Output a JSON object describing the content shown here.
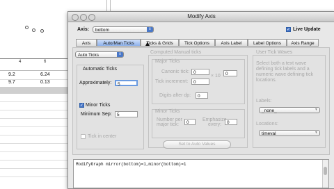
{
  "background": {
    "x_ticks": [
      "4",
      "6"
    ],
    "table_rows": [
      {
        "a": "9.2",
        "b": "6.24"
      },
      {
        "a": "9.7",
        "b": "0.13"
      }
    ]
  },
  "window": {
    "title": "Modify Axis",
    "axis_label": "Axis:",
    "axis_value": "bottom",
    "live_update_label": "Live Update",
    "tabs": [
      "Axis",
      "Auto/Man Ticks",
      "Ticks & Grids",
      "Tick Options",
      "Axis Label",
      "Label Options",
      "Axis Range"
    ],
    "active_tab": "Auto/Man Ticks",
    "mode_select": "Auto Ticks",
    "automatic": {
      "title": "Automatic Ticks",
      "approx_label": "Approximately:",
      "approx_value": "5",
      "minor_ticks_label": "Minor Ticks",
      "minor_sep_label": "Minimum Sep:",
      "minor_sep_value": "5",
      "tick_in_center_label": "Tick in center"
    },
    "computed": {
      "title": "Computed Manual ticks",
      "major_title": "Major Ticks",
      "canonic_label": "Canonic tick:",
      "canonic_value": "0",
      "increment_label": "Tick increment:",
      "increment_value": "0",
      "times10": "× 10",
      "exponent_value": "0",
      "digits_label": "Digits after dp:",
      "digits_value": "0",
      "minor_title": "Minor Ticks",
      "number_label_1": "Number per",
      "number_label_2": "major tick:",
      "number_value": "0",
      "emph_label_1": "Emphasize",
      "emph_label_2": "every:",
      "emph_value": "0",
      "set_button": "Set to Auto Values"
    },
    "user": {
      "title": "User Tick Waves",
      "desc": "Select both a text wave defining tick labels and a numeric wave defining tick locations.",
      "labels_label": "Labels:",
      "labels_value": "_none_",
      "locations_label": "Locations:",
      "locations_value": "timeval"
    },
    "command": "ModifyGraph mirror(bottom)=1,minor(bottom)=1"
  }
}
